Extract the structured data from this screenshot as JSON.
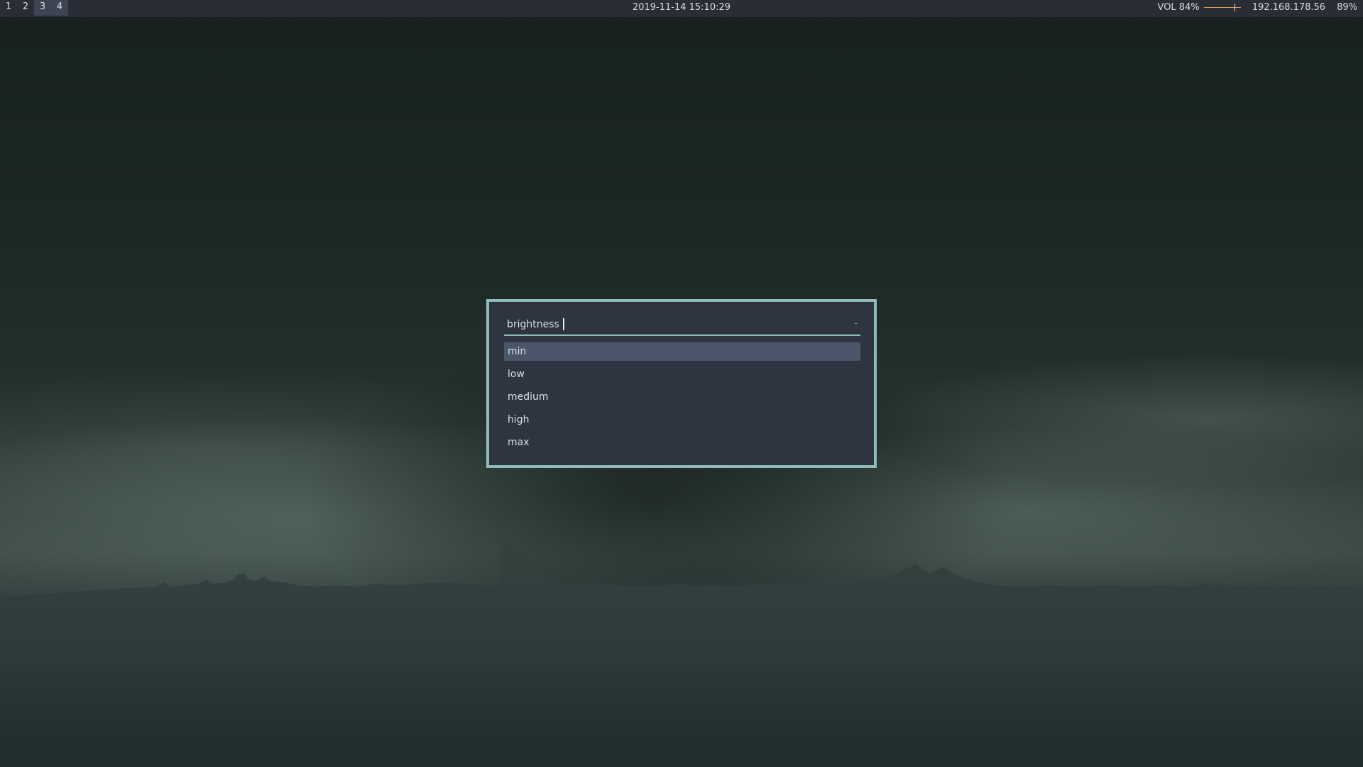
{
  "topbar": {
    "workspaces": [
      {
        "label": "1",
        "active": false
      },
      {
        "label": "2",
        "active": false
      },
      {
        "label": "3",
        "active": true
      },
      {
        "label": "4",
        "active": true
      }
    ],
    "datetime": "2019-11-14 15:10:29",
    "volume": {
      "label": "VOL 84%",
      "level": 0.84
    },
    "ip_address": "192.168.178.56",
    "battery": "89%"
  },
  "launcher": {
    "query": "brightness",
    "counter": "-",
    "options": [
      {
        "label": "min",
        "selected": true
      },
      {
        "label": "low",
        "selected": false
      },
      {
        "label": "medium",
        "selected": false
      },
      {
        "label": "high",
        "selected": false
      },
      {
        "label": "max",
        "selected": false
      }
    ]
  },
  "colors": {
    "bar_bg": "#282d36",
    "launcher_bg": "#2e3440",
    "launcher_border": "#8fbcbb",
    "selection": "#4c566a",
    "volume_accent": "#e0a24a"
  }
}
